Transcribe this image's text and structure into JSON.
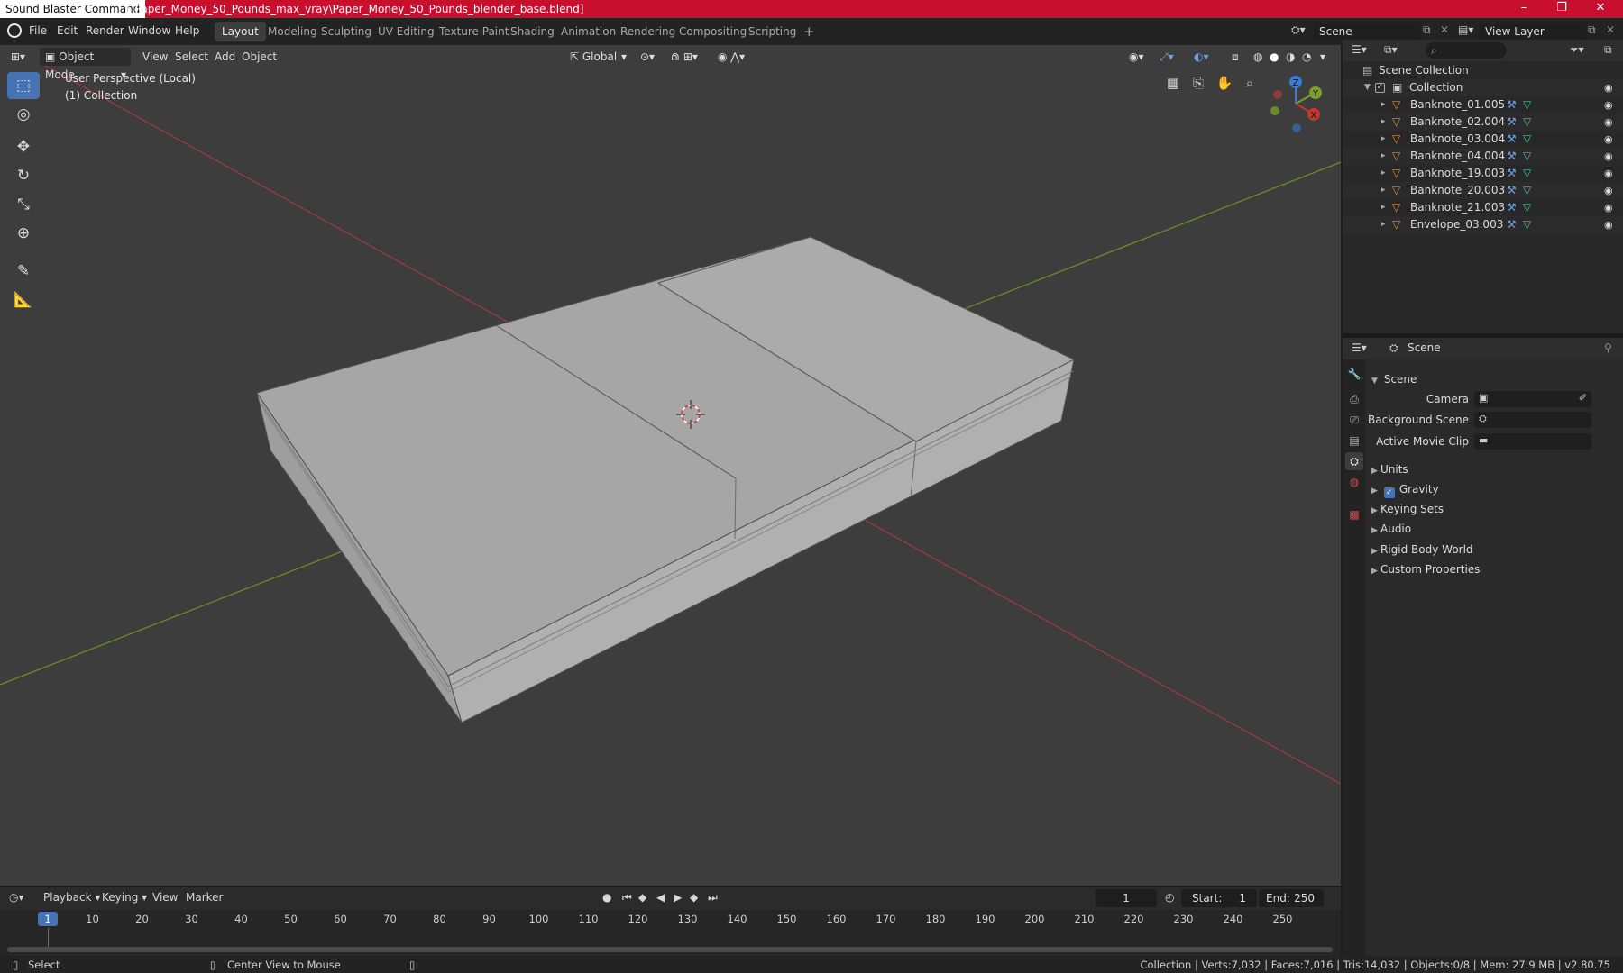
{
  "window": {
    "app_title": "Sound Blaster Command",
    "file_path": "1\\Paper_Money_50_Pounds_max_vray\\Paper_Money_50_Pounds_blender_base.blend]"
  },
  "menu": {
    "items": [
      "File",
      "Edit",
      "Render",
      "Window",
      "Help"
    ],
    "workspaces": [
      "Layout",
      "Modeling",
      "Sculpting",
      "UV Editing",
      "Texture Paint",
      "Shading",
      "Animation",
      "Rendering",
      "Compositing",
      "Scripting"
    ],
    "active_workspace": "Layout",
    "scene_name": "Scene",
    "view_layer": "View Layer"
  },
  "viewport": {
    "mode": "Object Mode",
    "menus": [
      "View",
      "Select",
      "Add",
      "Object"
    ],
    "orientation": "Global",
    "perspective_label": "User Perspective (Local)",
    "collection_label": "(1) Collection",
    "gizmo_axes": [
      "X",
      "Y",
      "Z"
    ]
  },
  "outliner": {
    "root": "Scene Collection",
    "collection": "Collection",
    "objects": [
      "Banknote_01.005",
      "Banknote_02.004",
      "Banknote_03.004",
      "Banknote_04.004",
      "Banknote_19.003",
      "Banknote_20.003",
      "Banknote_21.003",
      "Envelope_03.003"
    ]
  },
  "properties": {
    "context": "Scene",
    "panel_title": "Scene",
    "camera_label": "Camera",
    "background_scene_label": "Background Scene",
    "active_movie_clip_label": "Active Movie Clip",
    "sections": [
      "Units",
      "Gravity",
      "Keying Sets",
      "Audio",
      "Rigid Body World",
      "Custom Properties"
    ],
    "gravity_checked": true
  },
  "timeline": {
    "menus": [
      "Playback",
      "Keying",
      "View",
      "Marker"
    ],
    "current_frame": "1",
    "start_label": "Start:",
    "start_value": "1",
    "end_label": "End:",
    "end_value": "250",
    "ticks": [
      "1",
      "10",
      "20",
      "30",
      "40",
      "50",
      "60",
      "70",
      "80",
      "90",
      "100",
      "110",
      "120",
      "130",
      "140",
      "150",
      "160",
      "170",
      "180",
      "190",
      "200",
      "210",
      "220",
      "230",
      "240",
      "250"
    ]
  },
  "statusbar": {
    "left_action": "Select",
    "middle_action": "Center View to Mouse",
    "stats": "Collection | Verts:7,032 | Faces:7,016 | Tris:14,032 | Objects:0/8 | Mem: 27.9 MB | v2.80.75"
  },
  "colors": {
    "titlebar": "#c8102e",
    "accent": "#4772b3",
    "x_axis": "#c0392b",
    "y_axis": "#7da02d",
    "z_axis": "#3a7bd5"
  }
}
